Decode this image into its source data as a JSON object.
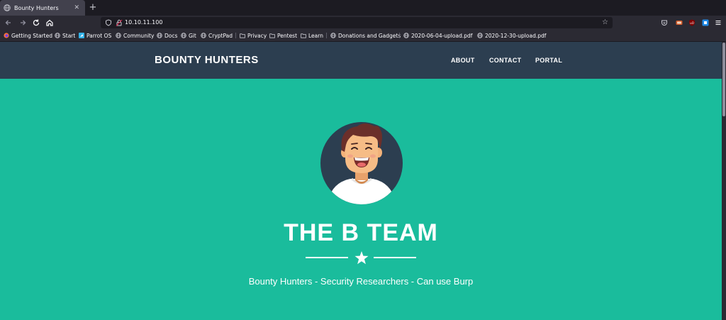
{
  "browser": {
    "tab_title": "Bounty Hunters",
    "close_glyph": "✕",
    "newtab_glyph": "+",
    "address": "10.10.11.100",
    "nav_icons": [
      "back-icon",
      "forward-icon",
      "reload-icon",
      "home-icon"
    ],
    "bookmarks": [
      {
        "label": "Getting Started",
        "icon": "firefox-icon"
      },
      {
        "label": "Start",
        "icon": "globe-icon"
      },
      {
        "label": "Parrot OS",
        "icon": "parrot-icon"
      },
      {
        "label": "Community",
        "icon": "globe-icon"
      },
      {
        "label": "Docs",
        "icon": "globe-icon"
      },
      {
        "label": "Git",
        "icon": "globe-icon"
      },
      {
        "label": "CryptPad",
        "icon": "globe-icon"
      },
      {
        "label": "Privacy",
        "icon": "folder-icon"
      },
      {
        "label": "Pentest",
        "icon": "folder-icon"
      },
      {
        "label": "Learn",
        "icon": "folder-icon"
      },
      {
        "label": "Donations and Gadgets",
        "icon": "globe-icon"
      },
      {
        "label": "2020-06-04-upload.pdf",
        "icon": "globe-icon"
      },
      {
        "label": "2020-12-30-upload.pdf",
        "icon": "globe-icon"
      }
    ]
  },
  "site": {
    "brand": "BOUNTY HUNTERS",
    "nav": [
      "ABOUT",
      "CONTACT",
      "PORTAL"
    ],
    "masthead_title": "THE B TEAM",
    "subheading": "Bounty Hunters - Security Researchers - Can use Burp"
  },
  "colors": {
    "primary": "#1abc9c",
    "header": "#2c3e50",
    "avatar_bg": "#2c3e50"
  }
}
